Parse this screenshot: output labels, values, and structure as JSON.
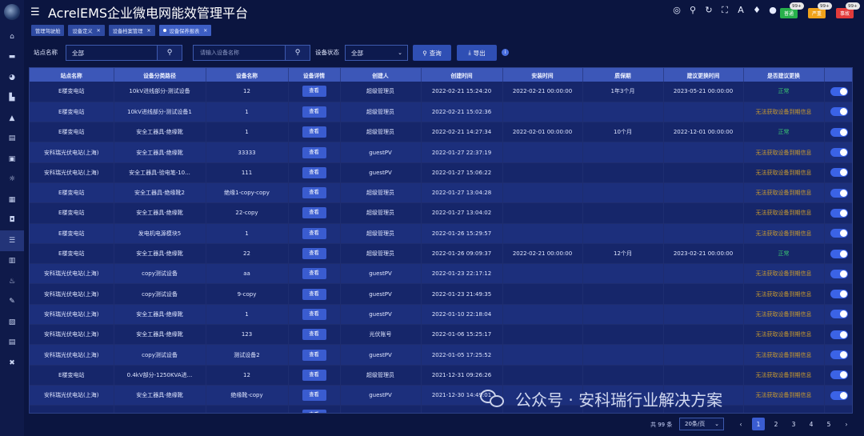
{
  "app": {
    "title": "AcrelEMS企业微电网能效管理平台"
  },
  "header_tools": [
    "target-icon",
    "search-icon",
    "refresh-icon",
    "fullscreen-icon",
    "text-icon",
    "shirt-icon",
    "user-icon"
  ],
  "badges": [
    {
      "label": "普通",
      "count": "99+",
      "color": "#27b04b"
    },
    {
      "label": "严重",
      "count": "99+",
      "color": "#f0a21b"
    },
    {
      "label": "事故",
      "count": "99+",
      "color": "#e23b3b"
    }
  ],
  "tabs": [
    {
      "label": "管理驾驶舱",
      "closable": false,
      "active": false
    },
    {
      "label": "设备定义",
      "closable": true,
      "active": false
    },
    {
      "label": "设备档案管理",
      "closable": true,
      "active": false
    },
    {
      "label": "设备保养报表",
      "closable": true,
      "active": true
    }
  ],
  "filter": {
    "site_label": "站点名称",
    "site_value": "全部",
    "device_placeholder": "请输入设备名称",
    "status_label": "设备状态",
    "status_value": "全部",
    "query_label": "查询",
    "export_label": "导出"
  },
  "table": {
    "headers": [
      "站点名称",
      "设备分类路径",
      "设备名称",
      "设备详情",
      "创建人",
      "创建时间",
      "安装时间",
      "质保期",
      "建议更换时间",
      "是否建议更换",
      ""
    ],
    "view_label": "查看",
    "rows": [
      [
        "E楼变电站",
        "10kV进线部分-测试设备",
        "12",
        "超级管理员",
        "2022-02-21 15:24:20",
        "2022-02-21 00:00:00",
        "1年3个月",
        "2023-05-21 00:00:00",
        "正常"
      ],
      [
        "E楼变电站",
        "10kV进线部分-测试设备1",
        "1",
        "超级管理员",
        "2022-02-21 15:02:36",
        "",
        "",
        "",
        "无法获取设备到期信息"
      ],
      [
        "E楼变电站",
        "安全工器具-绝缘靴",
        "1",
        "超级管理员",
        "2022-02-21 14:27:34",
        "2022-02-01 00:00:00",
        "10个月",
        "2022-12-01 00:00:00",
        "正常"
      ],
      [
        "安科瑞光伏电站(上海)",
        "安全工器具-绝缘靴",
        "33333",
        "guestPV",
        "2022-01-27 22:37:19",
        "",
        "",
        "",
        "无法获取设备到期信息"
      ],
      [
        "安科瑞光伏电站(上海)",
        "安全工器具-验电笔-10...",
        "111",
        "guestPV",
        "2022-01-27 15:06:22",
        "",
        "",
        "",
        "无法获取设备到期信息"
      ],
      [
        "E楼变电站",
        "安全工器具-绝缘靴2",
        "绝缘1-copy-copy",
        "超级管理员",
        "2022-01-27 13:04:28",
        "",
        "",
        "",
        "无法获取设备到期信息"
      ],
      [
        "E楼变电站",
        "安全工器具-绝缘靴",
        "22-copy",
        "超级管理员",
        "2022-01-27 13:04:02",
        "",
        "",
        "",
        "无法获取设备到期信息"
      ],
      [
        "E楼变电站",
        "发电机电源模块5",
        "1",
        "超级管理员",
        "2022-01-26 15:29:57",
        "",
        "",
        "",
        "无法获取设备到期信息"
      ],
      [
        "E楼变电站",
        "安全工器具-绝缘靴",
        "22",
        "超级管理员",
        "2022-01-26 09:09:37",
        "2022-02-21 00:00:00",
        "12个月",
        "2023-02-21 00:00:00",
        "正常"
      ],
      [
        "安科瑞光伏电站(上海)",
        "copy测试设备",
        "aa",
        "guestPV",
        "2022-01-23 22:17:12",
        "",
        "",
        "",
        "无法获取设备到期信息"
      ],
      [
        "安科瑞光伏电站(上海)",
        "copy测试设备",
        "9-copy",
        "guestPV",
        "2022-01-23 21:49:35",
        "",
        "",
        "",
        "无法获取设备到期信息"
      ],
      [
        "安科瑞光伏电站(上海)",
        "安全工器具-绝缘靴",
        "1",
        "guestPV",
        "2022-01-10 22:18:04",
        "",
        "",
        "",
        "无法获取设备到期信息"
      ],
      [
        "安科瑞光伏电站(上海)",
        "安全工器具-绝缘靴",
        "123",
        "光伏账号",
        "2022-01-06 15:25:17",
        "",
        "",
        "",
        "无法获取设备到期信息"
      ],
      [
        "安科瑞光伏电站(上海)",
        "copy测试设备",
        "测试设备2",
        "guestPV",
        "2022-01-05 17:25:52",
        "",
        "",
        "",
        "无法获取设备到期信息"
      ],
      [
        "E楼变电站",
        "0.4kV部分-1250KVA进...",
        "12",
        "超级管理员",
        "2021-12-31 09:26:26",
        "",
        "",
        "",
        "无法获取设备到期信息"
      ],
      [
        "安科瑞光伏电站(上海)",
        "安全工器具-绝缘靴",
        "绝缘靴-copy",
        "guestPV",
        "2021-12-30 14:49:01",
        "",
        "",
        "",
        "无法获取设备到期信息"
      ],
      [
        "",
        "",
        "",
        "",
        "",
        "",
        "",
        "",
        ""
      ]
    ]
  },
  "pagination": {
    "total": "共 99 条",
    "page_size": "20条/页",
    "pages": [
      "1",
      "2",
      "3",
      "4",
      "5"
    ],
    "current": "1"
  },
  "watermark": "公众号 · 安科瑞行业解决方案",
  "sidebar_icons": [
    "home-icon",
    "monitor-icon",
    "dashboard-icon",
    "chart-icon",
    "alarm-icon",
    "report-icon",
    "message-icon",
    "bulb-icon",
    "grid-icon",
    "camera-icon",
    "list-icon",
    "building-icon",
    "siren-icon",
    "edit-icon",
    "book-icon",
    "document-icon",
    "tools-icon"
  ]
}
